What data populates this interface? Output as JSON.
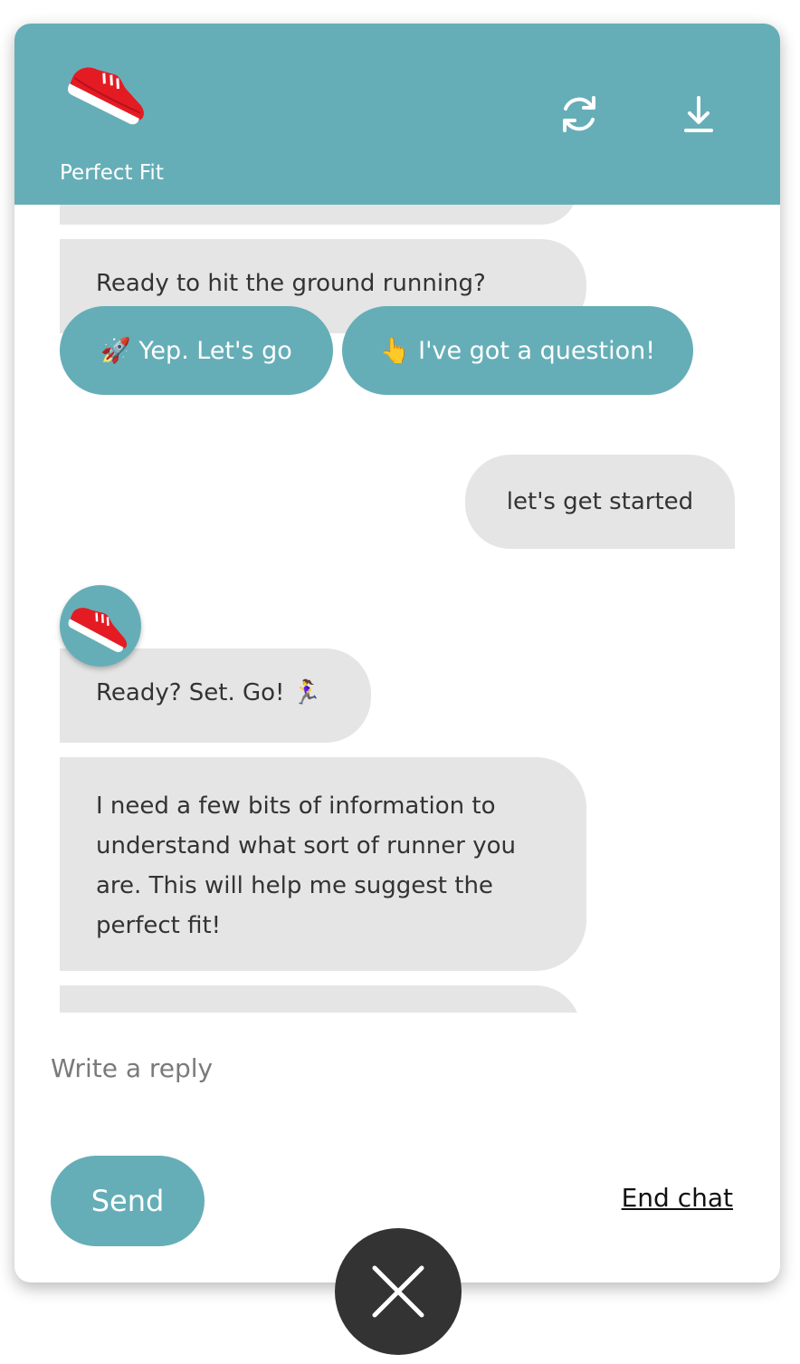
{
  "header": {
    "brand_name": "Perfect Fit",
    "logo_icon": "running-shoe-icon",
    "refresh_icon": "refresh-icon",
    "download_icon": "download-icon"
  },
  "messages": {
    "bot_ready_text": "Ready to hit the ground running?",
    "quick_replies": [
      {
        "label": "🚀 Yep. Let's go"
      },
      {
        "label": "👆 I've got a question!"
      }
    ],
    "user_text": "let's get started",
    "bot_go_text": "Ready? Set. Go! 🏃‍♀️",
    "bot_info_text": "I need a few bits of information to understand what sort of runner you are. This will help me suggest the perfect fit!"
  },
  "composer": {
    "placeholder": "Write a reply",
    "value": "",
    "send_label": "Send",
    "end_chat_label": "End chat"
  },
  "colors": {
    "brand": "#66aeb7",
    "bubble": "#e5e5e5",
    "close_button": "#333333"
  }
}
